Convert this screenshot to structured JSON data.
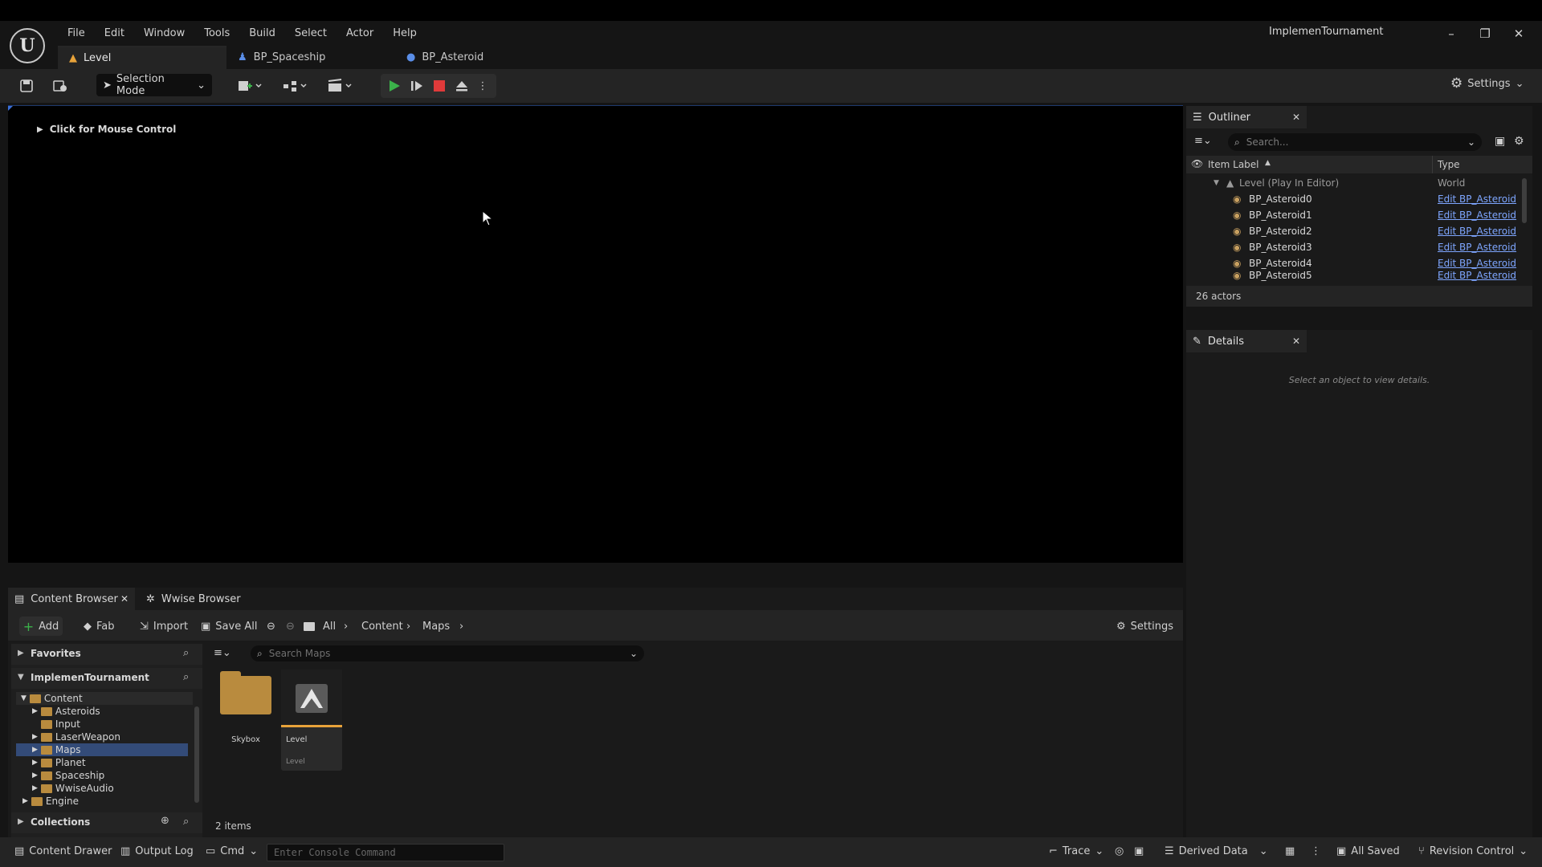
{
  "menu": [
    "File",
    "Edit",
    "Window",
    "Tools",
    "Build",
    "Select",
    "Actor",
    "Help"
  ],
  "tabs": [
    {
      "label": "Level"
    },
    {
      "label": "BP_Spaceship"
    },
    {
      "label": "BP_Asteroid"
    }
  ],
  "project_name": "ImplemenTournament",
  "toolbar": {
    "selection_mode": "Selection Mode",
    "settings": "Settings"
  },
  "viewport": {
    "hint": "Click for Mouse Control"
  },
  "outliner": {
    "title": "Outliner",
    "search_placeholder": "Search...",
    "col_label": "Item Label",
    "col_type": "Type",
    "root": {
      "label": "Level (Play In Editor)",
      "type": "World"
    },
    "items": [
      {
        "label": "BP_Asteroid0",
        "type": "Edit BP_Asteroid"
      },
      {
        "label": "BP_Asteroid1",
        "type": "Edit BP_Asteroid"
      },
      {
        "label": "BP_Asteroid2",
        "type": "Edit BP_Asteroid"
      },
      {
        "label": "BP_Asteroid3",
        "type": "Edit BP_Asteroid"
      },
      {
        "label": "BP_Asteroid4",
        "type": "Edit BP_Asteroid"
      },
      {
        "label": "BP_Asteroid5",
        "type": "Edit BP_Asteroid"
      }
    ],
    "count": "26 actors"
  },
  "details": {
    "title": "Details",
    "empty_message": "Select an object to view details."
  },
  "content_browser": {
    "tab_label": "Content Browser",
    "wwise_tab": "Wwise Browser",
    "add": "Add",
    "fab": "Fab",
    "import": "Import",
    "save_all": "Save All",
    "path": [
      "All",
      "Content",
      "Maps"
    ],
    "settings": "Settings",
    "favorites": "Favorites",
    "project": "ImplemenTournament",
    "tree": [
      "Content",
      "Asteroids",
      "Input",
      "LaserWeapon",
      "Maps",
      "Planet",
      "Spaceship",
      "WwiseAudio",
      "Engine"
    ],
    "collections": "Collections",
    "search_placeholder": "Search Maps",
    "assets": [
      {
        "name": "Skybox"
      },
      {
        "name": "Level",
        "type": "Level"
      }
    ],
    "item_count": "2 items"
  },
  "statusbar": {
    "content_drawer": "Content Drawer",
    "output_log": "Output Log",
    "cmd": "Cmd",
    "console_placeholder": "Enter Console Command",
    "trace": "Trace",
    "derived_data": "Derived Data",
    "all_saved": "All Saved",
    "revision_control": "Revision Control"
  },
  "colors": {
    "play": "#3bb24a",
    "stop": "#e03a3a",
    "link": "#7ea6ff",
    "selection": "#334b78",
    "folder": "#b98b3e"
  }
}
